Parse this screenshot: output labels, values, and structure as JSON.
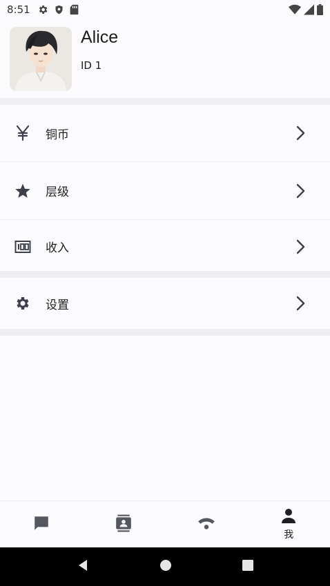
{
  "status_bar": {
    "time": "8:51",
    "left_icons": [
      "gear-icon",
      "shield-icon",
      "sd-card-icon"
    ],
    "right_icons": [
      "wifi-icon",
      "signal-icon",
      "battery-icon"
    ]
  },
  "profile": {
    "name": "Alice",
    "id_label": "ID 1"
  },
  "menu": {
    "group1": [
      {
        "label": "铜币",
        "icon": "yen-icon"
      },
      {
        "label": "层级",
        "icon": "star-icon"
      },
      {
        "label": "收入",
        "icon": "counter-icon"
      }
    ],
    "group2": [
      {
        "label": "设置",
        "icon": "gear-icon"
      }
    ]
  },
  "bottom_nav": {
    "items": [
      {
        "icon": "chat-icon",
        "label": ""
      },
      {
        "icon": "contacts-icon",
        "label": ""
      },
      {
        "icon": "wifi-icon",
        "label": ""
      },
      {
        "icon": "person-icon",
        "label": "我"
      }
    ]
  },
  "colors": {
    "background": "#fbfbfe",
    "divider": "#eeeef1",
    "icon": "#3d3f4a",
    "system_nav": "#000000"
  }
}
